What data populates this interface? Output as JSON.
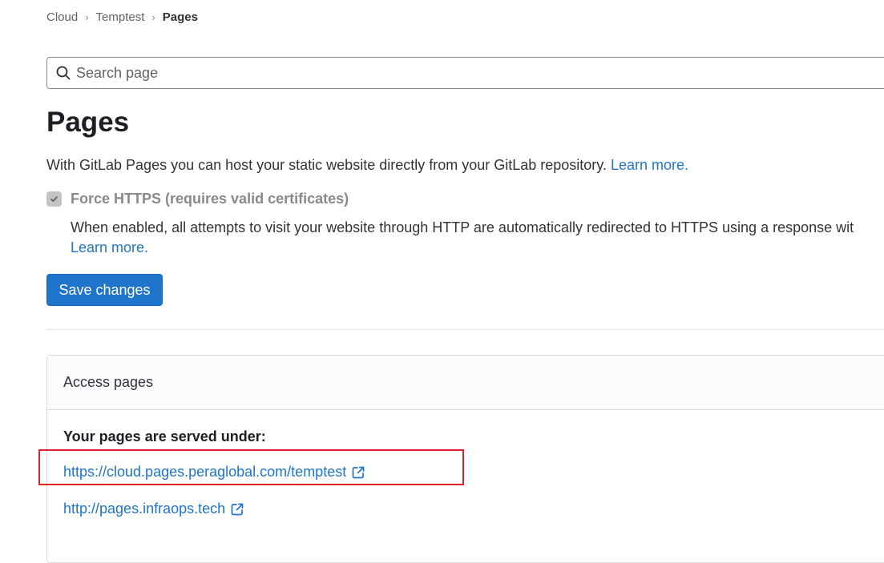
{
  "breadcrumb": {
    "items": [
      "Cloud",
      "Temptest"
    ],
    "current": "Pages"
  },
  "search": {
    "placeholder": "Search page"
  },
  "page": {
    "title": "Pages",
    "intro_text": "With GitLab Pages you can host your static website directly from your GitLab repository. ",
    "intro_link": "Learn more."
  },
  "force_https": {
    "label": "Force HTTPS (requires valid certificates)",
    "checked": true,
    "disabled": true,
    "help_text": "When enabled, all attempts to visit your website through HTTP are automatically redirected to HTTPS using a response wit",
    "help_link": "Learn more."
  },
  "save_button": {
    "label": "Save changes"
  },
  "access_pages": {
    "header": "Access pages",
    "served_label": "Your pages are served under:",
    "links": [
      "https://cloud.pages.peraglobal.com/temptest",
      "http://pages.infraops.tech"
    ]
  },
  "colors": {
    "link": "#1f75cb",
    "button": "#1f75cb",
    "highlight": "#e0202a"
  },
  "icons": {
    "search": "search-icon",
    "external": "external-link-icon",
    "check": "check-icon",
    "chevron": "chevron-right-icon"
  }
}
